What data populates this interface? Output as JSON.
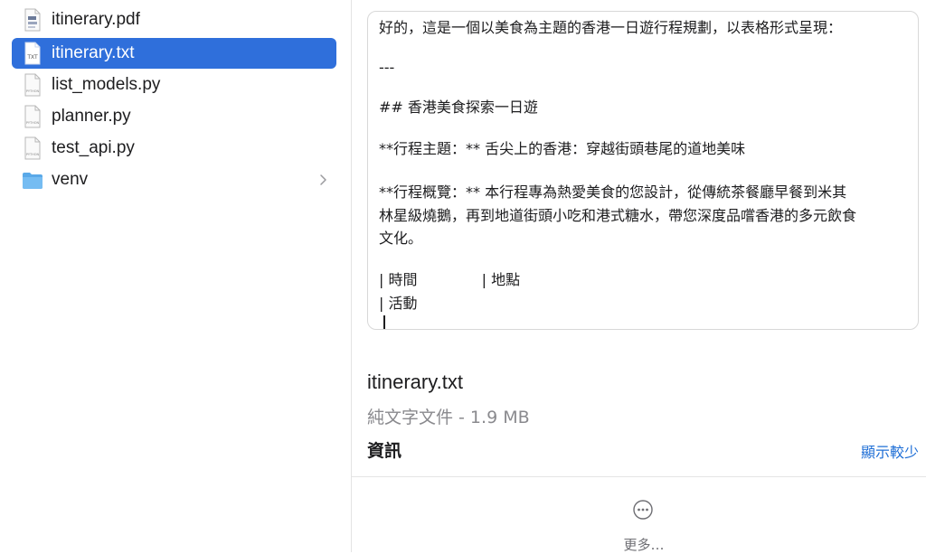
{
  "sidebar": {
    "files": [
      {
        "name": "itinerary.pdf",
        "icon": "pdf-file-icon",
        "selected": false
      },
      {
        "name": "itinerary.txt",
        "icon": "txt-file-icon",
        "selected": true
      },
      {
        "name": "list_models.py",
        "icon": "python-file-icon",
        "selected": false
      },
      {
        "name": "planner.py",
        "icon": "python-file-icon",
        "selected": false
      },
      {
        "name": "test_api.py",
        "icon": "python-file-icon",
        "selected": false
      },
      {
        "name": "venv",
        "icon": "folder-icon",
        "selected": false
      }
    ]
  },
  "preview": {
    "lines": [
      "好的，這是一個以美食為主題的香港一日遊行程規劃，以表格形式呈現：",
      "---",
      "## 香港美食探索一日遊",
      "**行程主題：** 舌尖上的香港：穿越街頭巷尾的道地美味",
      "**行程概覽：** 本行程專為熱愛美食的您設計，從傳統茶餐廳早餐到米其",
      "林星級燒鵝，再到地道街頭小吃和港式糖水，帶您深度品嚐香港的多元飲食",
      "文化。",
      "| 時間              | 地點",
      "| 活動"
    ]
  },
  "info": {
    "filename": "itinerary.txt",
    "subtitle": "純文字文件 - 1.9 MB",
    "section_heading": "資訊",
    "show_less_label": "顯示較少",
    "more_label": "更多…"
  },
  "colors": {
    "selection": "#2f6fdb",
    "link": "#1f6fd6"
  }
}
